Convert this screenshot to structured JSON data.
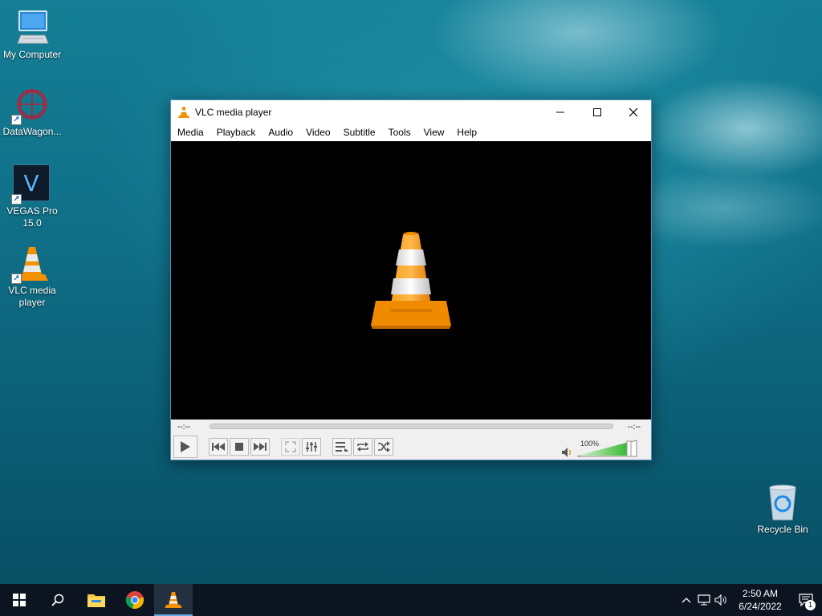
{
  "desktop": {
    "icons": [
      {
        "label": "My Computer",
        "icon": "computer-icon"
      },
      {
        "label": "DataWagon...",
        "icon": "datawagon-icon"
      },
      {
        "label": "VEGAS Pro 15.0",
        "icon": "vegas-pro-icon",
        "glyph": "V"
      },
      {
        "label": "VLC media player",
        "icon": "vlc-cone-icon"
      },
      {
        "label": "Recycle Bin",
        "icon": "recycle-bin-icon"
      }
    ]
  },
  "vlc": {
    "title": "VLC media player",
    "menu": [
      "Media",
      "Playback",
      "Audio",
      "Video",
      "Subtitle",
      "Tools",
      "View",
      "Help"
    ],
    "elapsed": "--:--",
    "remaining": "--:--",
    "volume_label": "100%",
    "volume_level": 1.0,
    "accent_color": "#f08a00"
  },
  "taskbar": {
    "time": "2:50 AM",
    "date": "6/24/2022",
    "notification_count": "1"
  }
}
